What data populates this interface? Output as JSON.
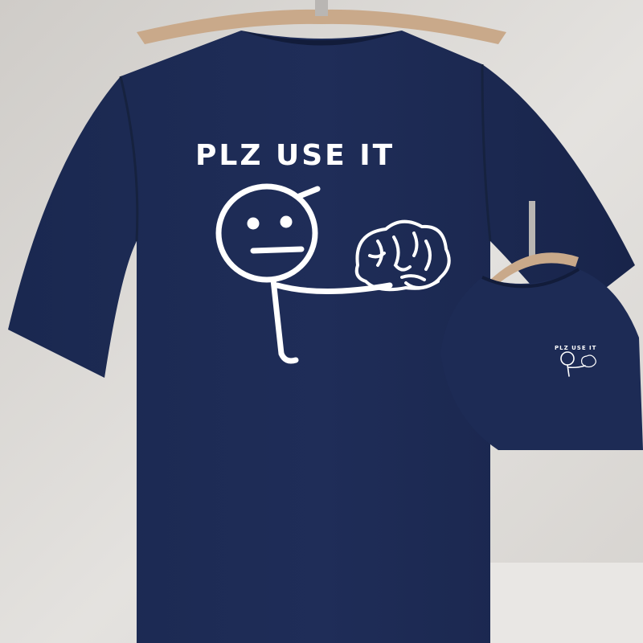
{
  "main_print": {
    "text": "PLZ USE IT"
  },
  "small_print": {
    "text": "PLZ USE IT"
  },
  "colors": {
    "background": "#d8d5d1",
    "background_light": "#e7e5e2",
    "shirt": "#1c2a52",
    "shirt_shadow": "#16223f",
    "print": "#ffffff",
    "hanger": "#c9a98a",
    "hanger_hook": "#b9b6b3"
  }
}
